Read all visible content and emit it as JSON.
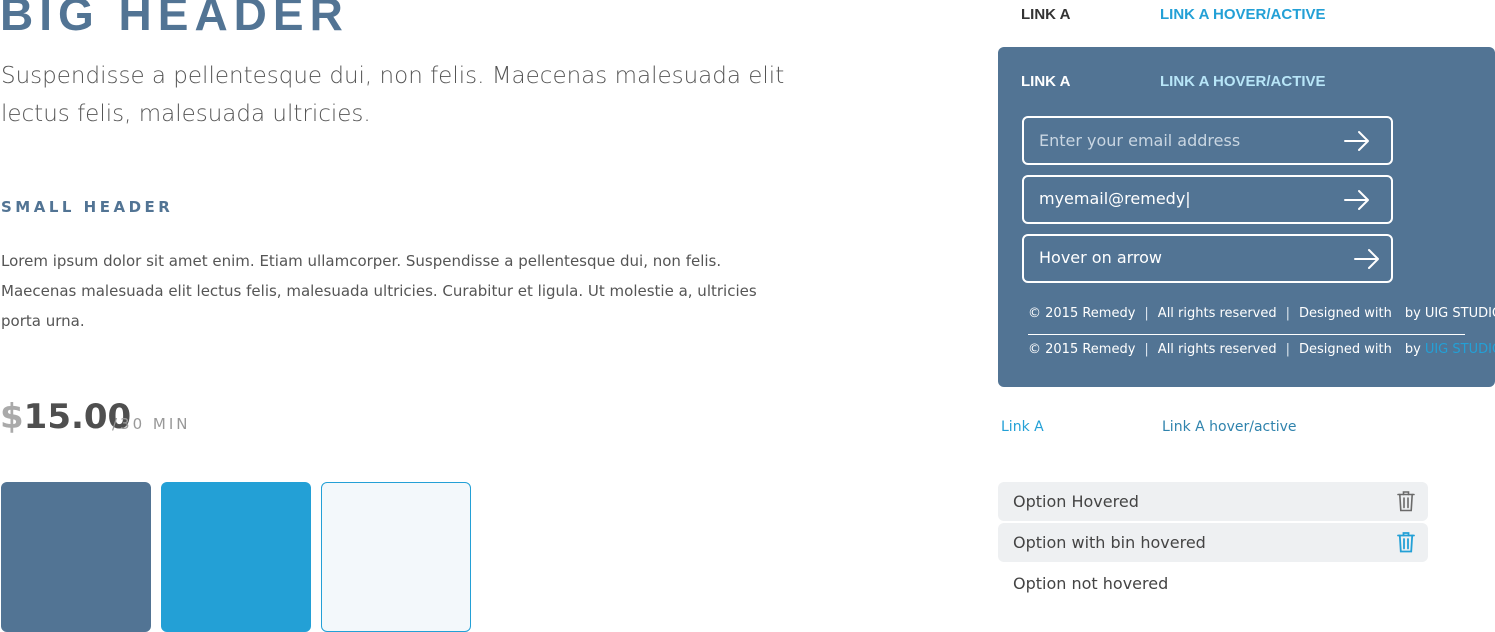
{
  "typography": {
    "big_header": "BIG HEADER",
    "lead": "Suspendisse a pellentesque dui, non felis. Maecenas malesuada elit lectus felis, malesuada ultricies.",
    "small_header": "SMALL HEADER",
    "body": "Lorem ipsum dolor sit amet enim. Etiam ullamcorper. Suspendisse a pellentesque dui, non felis. Maecenas malesuada elit lectus felis, malesuada ultricies. Curabitur et ligula. Ut molestie a, ultricies porta urna."
  },
  "price": {
    "currency": "$",
    "amount": "15.00",
    "unit": "/30 MIN"
  },
  "swatches": {
    "colors": [
      "#527494",
      "#23a0d6",
      "#f3f8fb"
    ]
  },
  "nav": {
    "link_a": "LINK A",
    "link_hover": "LINK A HOVER/ACTIVE"
  },
  "panel": {
    "link_a": "LINK A",
    "link_hover": "LINK A HOVER/ACTIVE",
    "fields": {
      "empty_placeholder": "Enter your email address",
      "typed_value": "myemail@remedy|",
      "hover_text": "Hover on arrow"
    },
    "footer": {
      "copyright": "© 2015 Remedy",
      "sep": "|",
      "rights": "All rights reserved",
      "designed": "Designed with",
      "by": "by",
      "studio": "UIG STUDIO"
    }
  },
  "small_links": {
    "link_a": "Link A",
    "link_hover": "Link A hover/active"
  },
  "options": [
    {
      "label": "Option Hovered"
    },
    {
      "label": "Option with bin hovered"
    },
    {
      "label": "Option not hovered"
    }
  ],
  "colors": {
    "primary": "#527494",
    "accent": "#23a0d6",
    "light_tint": "#f3f8fb"
  }
}
